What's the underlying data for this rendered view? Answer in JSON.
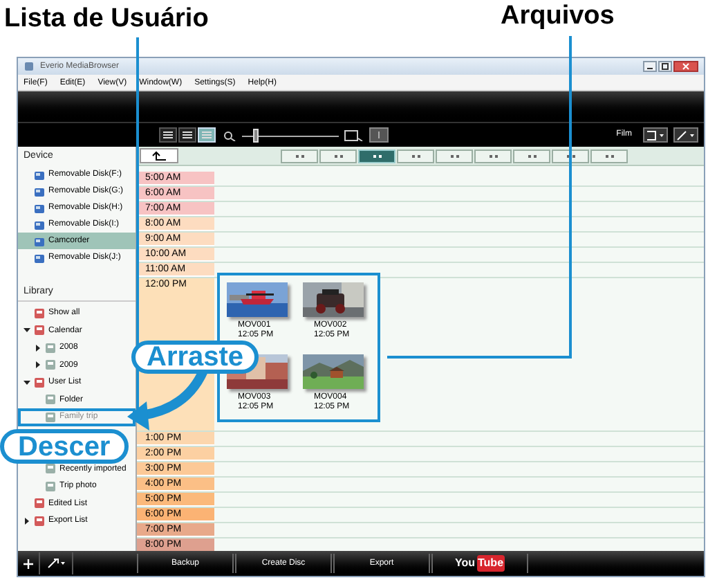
{
  "callouts": {
    "user_list": "Lista de Usuário",
    "files": "Arquivos",
    "drag": "Arraste",
    "drop": "Descer"
  },
  "window": {
    "title": "Everio MediaBrowser"
  },
  "menu": [
    "File(F)",
    "Edit(E)",
    "View(V)",
    "Window(W)",
    "Settings(S)",
    "Help(H)"
  ],
  "view_buttons": [
    {
      "selected": false
    },
    {
      "selected": false
    },
    {
      "selected": true
    }
  ],
  "zoom": {
    "level": 0.12
  },
  "film_label": "Film",
  "nav_buttons": [
    {
      "selected": false
    },
    {
      "selected": false
    },
    {
      "selected": true
    },
    {
      "selected": false
    },
    {
      "selected": false
    },
    {
      "selected": false
    },
    {
      "selected": false
    },
    {
      "selected": false
    },
    {
      "selected": false
    }
  ],
  "sidebar": {
    "device_header": "Device",
    "devices": [
      {
        "label": "Removable Disk(F:)",
        "selected": false
      },
      {
        "label": "Removable Disk(G:)",
        "selected": false
      },
      {
        "label": "Removable Disk(H:)",
        "selected": false
      },
      {
        "label": "Removable Disk(I:)",
        "selected": false
      },
      {
        "label": "Camcorder",
        "selected": true
      },
      {
        "label": "Removable Disk(J:)",
        "selected": false
      }
    ],
    "library_header": "Library",
    "library": [
      {
        "label": "Show all",
        "highlighted": false
      },
      {
        "label": "Calendar",
        "expanded": true,
        "highlighted": false,
        "children": [
          {
            "label": "2008",
            "expanded": false,
            "highlighted": false
          },
          {
            "label": "2009",
            "expanded": false,
            "highlighted": false
          }
        ]
      },
      {
        "label": "User List",
        "expanded": true,
        "highlighted": false,
        "children": [
          {
            "label": "Folder",
            "highlighted": false
          },
          {
            "label": "Family trip",
            "highlighted": true
          },
          {
            "label": "Recently imported",
            "highlighted": false
          },
          {
            "label": "Trip photo",
            "highlighted": false
          }
        ]
      },
      {
        "label": "Edited List",
        "highlighted": false
      },
      {
        "label": "Export List",
        "expanded": false,
        "highlighted": false
      }
    ]
  },
  "hours": [
    {
      "label": "5:00 AM",
      "color": "#f7c3c3"
    },
    {
      "label": "6:00 AM",
      "color": "#f7c3c3"
    },
    {
      "label": "7:00 AM",
      "color": "#f7c3c3"
    },
    {
      "label": "8:00 AM",
      "color": "#fddcc0"
    },
    {
      "label": "9:00 AM",
      "color": "#fddcc0"
    },
    {
      "label": "10:00 AM",
      "color": "#fddcc0"
    },
    {
      "label": "11:00 AM",
      "color": "#fddcc0"
    },
    {
      "label": "12:00 PM",
      "color": "#fde0b8",
      "files": [
        {
          "label": "MOV001",
          "time": "12:05 PM"
        },
        {
          "label": "MOV002",
          "time": "12:05 PM"
        },
        {
          "label": "MOV003",
          "time": "12:05 PM"
        },
        {
          "label": "MOV004",
          "time": "12:05 PM"
        }
      ]
    },
    {
      "label": "1:00 PM",
      "color": "#fcd6ad"
    },
    {
      "label": "2:00 PM",
      "color": "#fcd0a2"
    },
    {
      "label": "3:00 PM",
      "color": "#fcc997"
    },
    {
      "label": "4:00 PM",
      "color": "#fbbf86"
    },
    {
      "label": "5:00 PM",
      "color": "#fbb97b"
    },
    {
      "label": "6:00 PM",
      "color": "#fbb374"
    },
    {
      "label": "7:00 PM",
      "color": "#e8a98a"
    },
    {
      "label": "8:00 PM",
      "color": "#dea08f"
    }
  ],
  "bottom_bar": {
    "buttons": [
      "Backup",
      "Create Disc",
      "Export"
    ],
    "youtube": [
      "You",
      "Tube"
    ]
  }
}
